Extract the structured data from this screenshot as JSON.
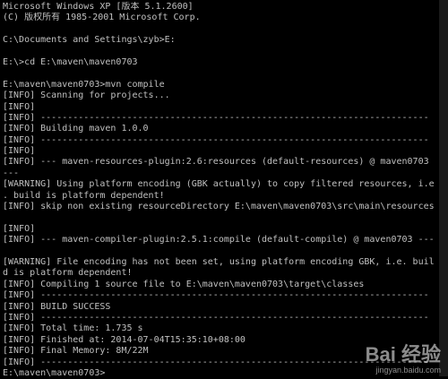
{
  "console": {
    "lines": [
      "Microsoft Windows XP [版本 5.1.2600]",
      "(C) 版权所有 1985-2001 Microsoft Corp.",
      "",
      "C:\\Documents and Settings\\zyb>E:",
      "",
      "E:\\>cd E:\\maven\\maven0703",
      "",
      "E:\\maven\\maven0703>mvn compile",
      "[INFO] Scanning for projects...",
      "[INFO]",
      "[INFO] ------------------------------------------------------------------------",
      "[INFO] Building maven 1.0.0",
      "[INFO] ------------------------------------------------------------------------",
      "[INFO]",
      "[INFO] --- maven-resources-plugin:2.6:resources (default-resources) @ maven0703",
      "---",
      "[WARNING] Using platform encoding (GBK actually) to copy filtered resources, i.e",
      ". build is platform dependent!",
      "[INFO] skip non existing resourceDirectory E:\\maven\\maven0703\\src\\main\\resources",
      "",
      "[INFO]",
      "[INFO] --- maven-compiler-plugin:2.5.1:compile (default-compile) @ maven0703 ---",
      "",
      "[WARNING] File encoding has not been set, using platform encoding GBK, i.e. buil",
      "d is platform dependent!",
      "[INFO] Compiling 1 source file to E:\\maven\\maven0703\\target\\classes",
      "[INFO] ------------------------------------------------------------------------",
      "[INFO] BUILD SUCCESS",
      "[INFO] ------------------------------------------------------------------------",
      "[INFO] Total time: 1.735 s",
      "[INFO] Finished at: 2014-07-04T15:35:10+08:00",
      "[INFO] Final Memory: 8M/22M",
      "[INFO] ------------------------------------------------------------------------",
      "E:\\maven\\maven0703>"
    ]
  },
  "watermark": {
    "logo_text": "Bai 经验",
    "url": "jingyan.baidu.com"
  }
}
